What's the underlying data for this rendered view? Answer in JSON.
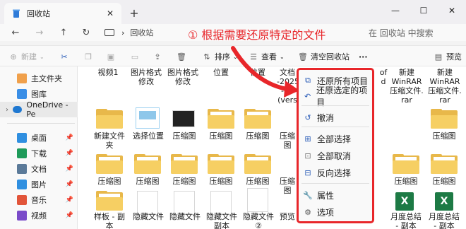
{
  "window": {
    "tab_title": "回收站",
    "new_tab": "+",
    "controls": [
      "—",
      "☐",
      "✕"
    ]
  },
  "address": {
    "path": "回收站",
    "search_placeholder": "在 回收站 中搜索"
  },
  "annotation": "① 根据需要还原特定的文件",
  "toolbar": {
    "new": "新建",
    "sort": "排序",
    "view": "查看",
    "empty_bin": "清空回收站",
    "more": "···",
    "preview": "预览"
  },
  "sidebar": {
    "items": [
      {
        "label": "主文件夹",
        "pinned": false
      },
      {
        "label": "图库",
        "pinned": false
      },
      {
        "label": "OneDrive - Pe",
        "pinned": false
      },
      {
        "label": "桌面",
        "pinned": true
      },
      {
        "label": "下载",
        "pinned": true
      },
      {
        "label": "文档",
        "pinned": true
      },
      {
        "label": "图片",
        "pinned": true
      },
      {
        "label": "音乐",
        "pinned": true
      },
      {
        "label": "视频",
        "pinned": true
      }
    ]
  },
  "files": {
    "row1": [
      "视频1",
      "图片格式修改",
      "图片格式修改",
      "位置",
      "位置",
      "文档\n-2025\n-03\n(vers",
      "",
      "of\nd",
      "新建\nWinRAR\n压缩文件.\nrar",
      "新建\nWinRAR\n压缩文件.\nrar"
    ],
    "row2": [
      "新建文件夹",
      "选择位置",
      "压缩图",
      "压缩图",
      "压缩图",
      "压缩图",
      "",
      "",
      "",
      "压缩图"
    ],
    "row3": [
      "压缩图",
      "压缩图",
      "压缩图",
      "压缩图",
      "压缩图",
      "压缩图",
      "",
      "",
      "压缩图",
      "压缩图"
    ],
    "row4": [
      "样板 - 副\n本",
      "隐藏文件",
      "隐藏文件",
      "隐藏文件\n副本",
      "隐藏文件\n②",
      "预览",
      "",
      "",
      "月度总结\n- 副本",
      "月度总结\n- 副本"
    ]
  },
  "context_menu": {
    "items": [
      {
        "label": "还原所有项目",
        "icon": "restore-all-icon"
      },
      {
        "label": "还原选定的项目",
        "icon": "restore-selected-icon"
      },
      {
        "label": "撤消",
        "icon": "undo-icon"
      },
      {
        "label": "全部选择",
        "icon": "select-all-icon"
      },
      {
        "label": "全部取消",
        "icon": "select-none-icon"
      },
      {
        "label": "反向选择",
        "icon": "invert-selection-icon"
      },
      {
        "label": "属性",
        "icon": "properties-icon"
      },
      {
        "label": "选项",
        "icon": "options-icon"
      }
    ]
  },
  "colors": {
    "accent_red": "#e8262a",
    "folder": "#f6cf63",
    "excel": "#1d7a45"
  }
}
